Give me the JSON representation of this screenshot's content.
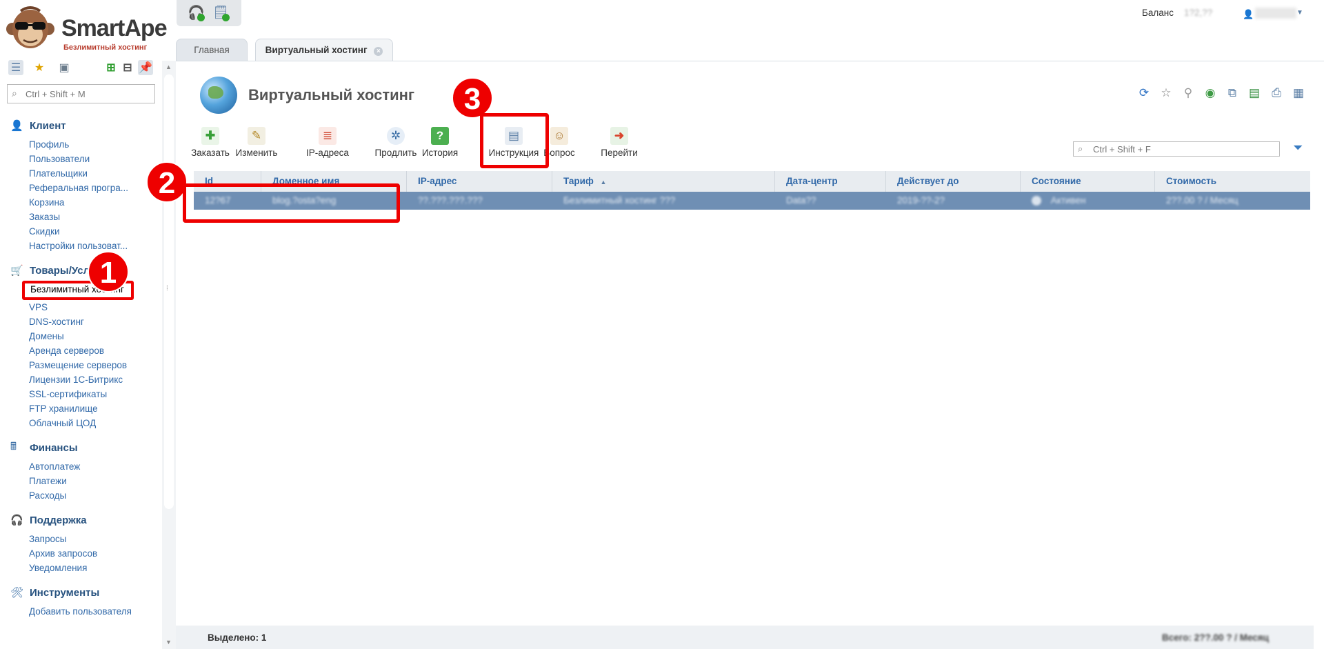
{
  "brand": {
    "name": "SmartApe",
    "tagline": "Безлимитный хостинг"
  },
  "sidebar": {
    "search_placeholder": "Ctrl + Shift + M",
    "groups": [
      {
        "title": "Клиент",
        "icon": "user-icon",
        "items": [
          "Профиль",
          "Пользователи",
          "Плательщики",
          "Реферальная програ...",
          "Корзина",
          "Заказы",
          "Скидки",
          "Настройки пользоват..."
        ]
      },
      {
        "title": "Товары/Усл",
        "icon": "cart-icon",
        "items": [
          "Безлимитный хостинг",
          "VPS",
          "DNS-хостинг",
          "Домены",
          "Аренда серверов",
          "Размещение серверов",
          "Лицензии 1С-Битрикс",
          "SSL-сертификаты",
          "FTP хранилище",
          "Облачный ЦОД"
        ]
      },
      {
        "title": "Финансы",
        "icon": "cash-register-icon",
        "items": [
          "Автоплатеж",
          "Платежи",
          "Расходы"
        ]
      },
      {
        "title": "Поддержка",
        "icon": "headset-icon",
        "items": [
          "Запросы",
          "Архив запросов",
          "Уведомления"
        ]
      },
      {
        "title": "Инструменты",
        "icon": "tools-icon",
        "items": [
          "Добавить пользователя"
        ]
      }
    ]
  },
  "topbar": {
    "balance_label": "Баланс",
    "balance_value": "1?2,??",
    "account": ""
  },
  "tabs": [
    {
      "label": "Главная"
    },
    {
      "label": "Виртуальный хостинг"
    }
  ],
  "page": {
    "title": "Виртуальный хостинг"
  },
  "actions": [
    {
      "label": "Заказать",
      "icon": "order-plus-icon"
    },
    {
      "label": "Изменить",
      "icon": "edit-icon"
    },
    {
      "label": "IP-адреса",
      "icon": "ip-addresses-icon"
    },
    {
      "label": "Продлить",
      "icon": "renew-compass-icon"
    },
    {
      "label": "История",
      "icon": "history-icon"
    },
    {
      "label": "Инструкция",
      "icon": "instruction-icon"
    },
    {
      "label": "Вопрос",
      "icon": "question-user-icon"
    },
    {
      "label": "Перейти",
      "icon": "goto-icon"
    }
  ],
  "table_search_placeholder": "Ctrl + Shift + F",
  "table": {
    "columns": [
      "Id",
      "Доменное имя",
      "IP-адрес",
      "Тариф",
      "Дата-центр",
      "Действует до",
      "Состояние",
      "Стоимость"
    ],
    "rows": [
      [
        "12?67",
        "blog.?osta?eng",
        "??.???.???.???",
        "Безлимитный хостинг ???",
        "Data??",
        "2019-??-2?",
        "Активен",
        "2??.00 ? / Месяц"
      ]
    ]
  },
  "footer": {
    "selected": "Выделено: 1",
    "total": "Всего: 2??.00 ? / Месяц"
  },
  "annotations": {
    "badge1": "1",
    "badge2": "2",
    "badge3": "3"
  }
}
